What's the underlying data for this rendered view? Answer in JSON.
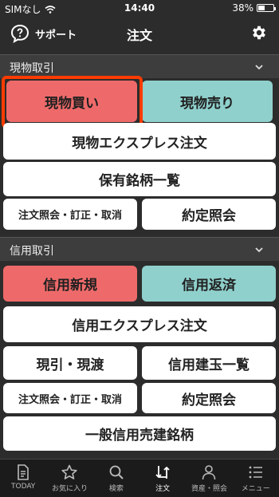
{
  "status_bar": {
    "carrier": "SIMなし",
    "time": "14:40",
    "battery": "38%",
    "battery_level": 0.38
  },
  "header": {
    "support_label": "サポート",
    "title": "注文"
  },
  "genbutsu": {
    "title": "現物取引",
    "buy": "現物買い",
    "sell": "現物売り",
    "express": "現物エクスプレス注文",
    "holdings": "保有銘柄一覧",
    "order_inquiry": "注文照会・訂正・取消",
    "execution_inquiry": "約定照会"
  },
  "shinyo": {
    "title": "信用取引",
    "new": "信用新規",
    "repay": "信用返済",
    "express": "信用エクスプレス注文",
    "genbiki": "現引・現渡",
    "positions": "信用建玉一覧",
    "order_inquiry": "注文照会・訂正・取消",
    "execution_inquiry": "約定照会",
    "general_margin": "一般信用売建銘柄"
  },
  "tabbar": {
    "items": [
      {
        "label": "TODAY",
        "icon": "document-icon"
      },
      {
        "label": "お気に入り",
        "icon": "star-icon"
      },
      {
        "label": "検索",
        "icon": "search-icon"
      },
      {
        "label": "注文",
        "icon": "order-icon",
        "active": true
      },
      {
        "label": "資産・照会",
        "icon": "person-icon"
      },
      {
        "label": "メニュー",
        "icon": "menu-icon"
      }
    ]
  }
}
